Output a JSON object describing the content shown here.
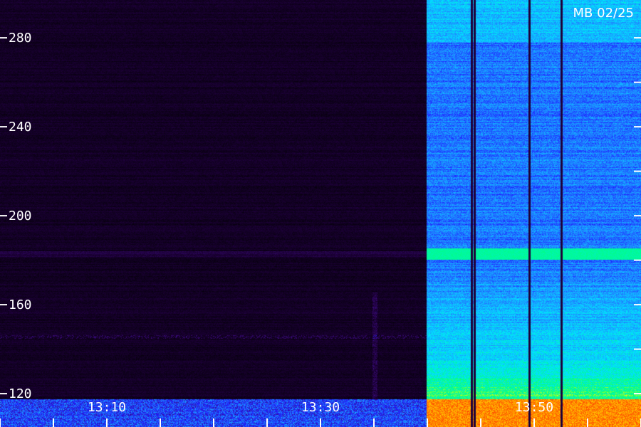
{
  "chart_data": {
    "type": "heatmap",
    "title": "",
    "xlabel": "",
    "ylabel": "",
    "station_label": "MB 02/25",
    "y_axis": {
      "range": [
        105,
        297
      ],
      "ticks": [
        {
          "value": 120,
          "label": "120"
        },
        {
          "value": 160,
          "label": "160"
        },
        {
          "value": 200,
          "label": "200"
        },
        {
          "value": 240,
          "label": "240"
        },
        {
          "value": 280,
          "label": "280"
        }
      ]
    },
    "x_axis": {
      "labels": [
        {
          "time": "13:10",
          "label": "13:10"
        },
        {
          "time": "13:30",
          "label": "13:30"
        },
        {
          "time": "13:50",
          "label": "13:50"
        }
      ],
      "minor_tick_interval_minutes": 5
    },
    "segments": [
      {
        "name": "",
        "start_fraction": 0.0,
        "end_fraction": 0.665,
        "intensity": 0.08
      },
      {
        "name": "",
        "start_fraction": 0.665,
        "end_fraction": 1.0,
        "intensity": 0.55
      }
    ],
    "features": [
      {
        "kind": "horizontal-band",
        "freq": 183,
        "intensity": 0.75
      },
      {
        "kind": "vertical-gap",
        "at_fraction": 0.735
      },
      {
        "kind": "vertical-gap",
        "at_fraction": 0.74
      },
      {
        "kind": "vertical-gap",
        "at_fraction": 0.825
      },
      {
        "kind": "vertical-gap",
        "at_fraction": 0.875
      }
    ],
    "colormap": [
      "#000000",
      "#1a0033",
      "#3a0a7a",
      "#2020ff",
      "#1e90ff",
      "#00e5ff",
      "#00ff80",
      "#ffff00",
      "#ff8000",
      "#ff0000"
    ]
  }
}
